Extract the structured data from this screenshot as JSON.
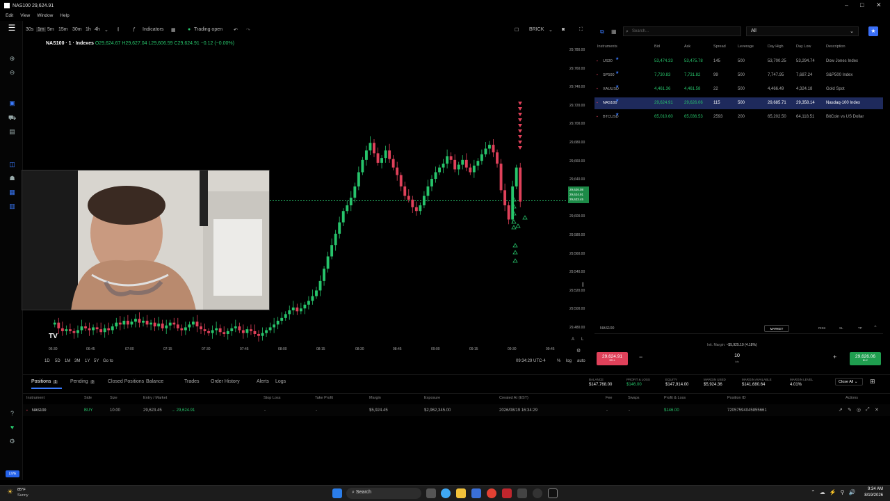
{
  "window": {
    "title": "NAS100 29,624.91"
  },
  "menu": [
    "Edit",
    "View",
    "Window",
    "Help"
  ],
  "chart_toolbar": {
    "intervals": [
      "30s",
      "1m",
      "5m",
      "15m",
      "30m",
      "1h",
      "4h"
    ],
    "indicators": "Indicators",
    "trading_status": "Trading open",
    "chart_type": "BRICK"
  },
  "symbol_line": {
    "symbol": "NAS100 · 1 · Indexes",
    "open": "O29,624.67",
    "high": "H29,627.04",
    "low": "L29,606.59",
    "close": "C29,624.91",
    "change": "−0.12 (−0.00%)"
  },
  "price_axis": [
    "29,780.00",
    "29,760.00",
    "29,740.00",
    "29,720.00",
    "29,700.00",
    "29,680.00",
    "29,660.00",
    "29,640.00",
    "29,620.00",
    "29,600.00",
    "29,580.00",
    "29,560.00",
    "29,540.00",
    "29,520.00",
    "29,500.00",
    "29,480.00"
  ],
  "current_price": {
    "bid": "29,626.08",
    "last": "29,624.91",
    "ask": "29,623.45"
  },
  "time_axis": [
    "06:30",
    "06:45",
    "07:00",
    "07:15",
    "07:30",
    "07:45",
    "08:00",
    "08:15",
    "08:30",
    "08:45",
    "09:00",
    "09:15",
    "09:30",
    "09:45"
  ],
  "range_bar": {
    "ranges": [
      "1D",
      "5D",
      "1M",
      "3M",
      "1Y",
      "5Y"
    ],
    "goto": "Go to",
    "clock": "09:34:29 UTC-4",
    "log": "log",
    "auto": "auto",
    "pct": "%"
  },
  "watchlist": {
    "search_placeholder": "Search...",
    "filter": "All",
    "columns": [
      "Instruments",
      "Bid",
      "Ask",
      "Spread",
      "Leverage",
      "Day High",
      "Day Low",
      "Description"
    ],
    "rows": [
      {
        "instrument": "US30",
        "bid": "53,474.33",
        "ask": "53,475.78",
        "spread": "145",
        "leverage": "500",
        "high": "53,700.25",
        "low": "53,294.74",
        "desc": "Dow Jones Index"
      },
      {
        "instrument": "SP500",
        "bid": "7,730.83",
        "ask": "7,731.82",
        "spread": "99",
        "leverage": "500",
        "high": "7,747.95",
        "low": "7,687.24",
        "desc": "S&P500 Index"
      },
      {
        "instrument": "XAUUSD",
        "bid": "4,461.36",
        "ask": "4,461.58",
        "spread": "22",
        "leverage": "500",
        "high": "4,466.49",
        "low": "4,324.18",
        "desc": "Gold Spot"
      },
      {
        "instrument": "NAS100",
        "bid": "29,624.91",
        "ask": "29,626.06",
        "spread": "115",
        "leverage": "500",
        "high": "29,685.71",
        "low": "29,358.14",
        "desc": "Nasdaq-100 Index"
      },
      {
        "instrument": "BTCUSD",
        "bid": "65,010.60",
        "ask": "65,036.53",
        "spread": "2593",
        "leverage": "200",
        "high": "65,202.50",
        "low": "64,118.51",
        "desc": "BitCoin vs US Dollar"
      }
    ]
  },
  "ticket": {
    "symbol": "NAS100",
    "order_type": "MARKET",
    "margin_label": "Init. Margin:",
    "margin": "~$5,925.10 (4.18%)",
    "sell_price": "29,624.91",
    "sell_label": "SELL",
    "buy_price": "29,626.06",
    "buy_label": "BUY",
    "qty": "10",
    "qty_unit": "lots",
    "btn1": "RISK",
    "btn2": "SL",
    "btn3": "TP",
    "minus": "−",
    "plus": "+"
  },
  "tabs": [
    {
      "label": "Positions",
      "count": "1"
    },
    {
      "label": "Pending",
      "count": "0"
    },
    {
      "label": "Closed Positions"
    },
    {
      "label": "Balance"
    },
    {
      "label": "Trades"
    },
    {
      "label": "Order History"
    },
    {
      "label": "Alerts"
    },
    {
      "label": "Logs"
    }
  ],
  "account": [
    {
      "label": "BALANCE",
      "value": "$147,768.00"
    },
    {
      "label": "PROFIT & LOSS",
      "value": "$146.00"
    },
    {
      "label": "EQUITY",
      "value": "$147,914.00"
    },
    {
      "label": "MARGIN USED",
      "value": "$5,924.36"
    },
    {
      "label": "MARGIN AVAILABLE",
      "value": "$141,680.64"
    },
    {
      "label": "MARGIN LEVEL",
      "value": "4.01%"
    }
  ],
  "close_all": "Close All",
  "positions": {
    "columns": [
      "Instrument",
      "Side",
      "Size",
      "Entry / Market",
      "Stop Loss",
      "Take Profit",
      "Margin",
      "Exposure",
      "Created At (EST)",
      "Fee",
      "Swaps",
      "Profit & Loss",
      "Position ID",
      "Actions"
    ],
    "rows": [
      {
        "instrument": "NAS100",
        "side": "BUY",
        "size": "10.00",
        "entry": "29,623.45",
        "market": "→ 29,624.91",
        "sl": "-",
        "tp": "-",
        "margin": "$5,924.45",
        "exposure": "$2,962,345.00",
        "created": "2026/08/19 16:34:29",
        "fee": "-",
        "swaps": "-",
        "pnl": "$146.00",
        "id": "72057594045855661"
      }
    ]
  },
  "taskbar": {
    "weather_temp": "85°F",
    "weather_desc": "Sunny",
    "search": "Search",
    "time": "9:34 AM",
    "date": "8/19/2026"
  },
  "live_badge": "LIVE",
  "chart_data": {
    "type": "candlestick",
    "symbol": "NAS100",
    "ylim": [
      29470,
      29790
    ],
    "x_labels": [
      "06:30",
      "06:45",
      "07:00",
      "07:15",
      "07:30",
      "07:45",
      "08:00",
      "08:15",
      "08:30",
      "08:45",
      "09:00",
      "09:15",
      "09:30",
      "09:45"
    ],
    "close_series": [
      29496,
      29490,
      29487,
      29489,
      29487,
      29485,
      29488,
      29492,
      29490,
      29488,
      29491,
      29489,
      29486,
      29490,
      29488,
      29492,
      29496,
      29494,
      29498,
      29494,
      29497,
      29500,
      29496,
      29498,
      29494,
      29496,
      29492,
      29495,
      29490,
      29493,
      29496,
      29494,
      29490,
      29488,
      29491,
      29494,
      29497,
      29492,
      29489,
      29487,
      29485,
      29488,
      29490,
      29486,
      29484,
      29487,
      29490,
      29492,
      29488,
      29485,
      29489,
      29487,
      29484,
      29482,
      29485,
      29488,
      29491,
      29494,
      29498,
      29501,
      29505,
      29509,
      29512,
      29508,
      29511,
      29515,
      29519,
      29524,
      29530,
      29540,
      29553,
      29566,
      29578,
      29590,
      29602,
      29614,
      29620,
      29628,
      29640,
      29655,
      29668,
      29678,
      29686,
      29675,
      29665,
      29670,
      29678,
      29669,
      29660,
      29652,
      29640,
      29630,
      29626,
      29618,
      29614,
      29620,
      29630,
      29640,
      29648,
      29655,
      29660,
      29664,
      29672,
      29668,
      29658,
      29663,
      29668,
      29660,
      29655,
      29662,
      29667,
      29674,
      29680,
      29684,
      29676,
      29664,
      29636,
      29620,
      29605,
      29640,
      29660,
      29624
    ],
    "sell_markers": 9,
    "buy_markers": 10
  }
}
